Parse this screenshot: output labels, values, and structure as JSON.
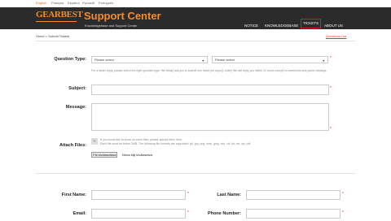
{
  "languages": [
    "English",
    "Français",
    "Español",
    "Русский",
    "Português"
  ],
  "header": {
    "logo": "GEARBEST",
    "title": "Support Center",
    "subtitle": "Knowledgebase and Support Center",
    "nav": [
      {
        "label": "NOTICE"
      },
      {
        "label": "KNOWLEDGEBASE"
      },
      {
        "label": "TICKETS",
        "active": true
      },
      {
        "label": "ABOUT US"
      }
    ]
  },
  "breadcrumb": "Home > Submit Tickets",
  "questions_link": "Questions List",
  "form": {
    "question_type_label": "Question Type:",
    "select1_value": "Please select",
    "select2_value": "Please select",
    "question_type_hint": "For a faster reply, please select the right question type. We kindly ask you to submit one ticket per topic(1 order) We will reply you within 24 hours except on weekends and public holidays.",
    "subject_label": "Subject:",
    "message_label": "Message:",
    "attach_label": "Attach Files:",
    "attach_hint1": "If you would like to show us some files, please upload them here.",
    "attach_hint2": "Each file must be below 2MB. The following file formats are supported: gif, jpg, png, bmp, jpeg, doc, xls, txt, rar, zip, pdf",
    "file_button": "Făl kiválasztása",
    "file_status": "Nincs fájl kiválasztva",
    "first_name_label": "First Name:",
    "last_name_label": "Last Name:",
    "email_label": "Email:",
    "phone_label": "Phone Number:",
    "required_mark": "*"
  },
  "colors": {
    "accent": "#f48c2a",
    "header_bg": "#2b2b2b",
    "active_border": "#d61c1c",
    "link": "#dd3333"
  }
}
